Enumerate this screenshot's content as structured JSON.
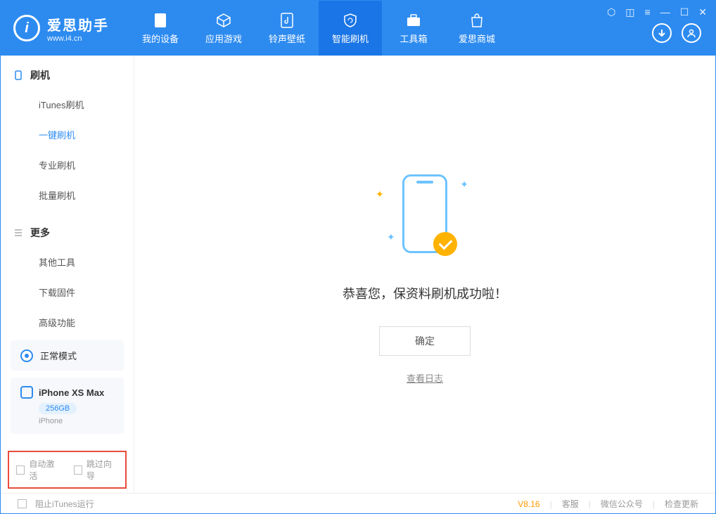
{
  "logo": {
    "title": "爱思助手",
    "url": "www.i4.cn",
    "mark": "i"
  },
  "nav": [
    {
      "label": "我的设备"
    },
    {
      "label": "应用游戏"
    },
    {
      "label": "铃声壁纸"
    },
    {
      "label": "智能刷机"
    },
    {
      "label": "工具箱"
    },
    {
      "label": "爱思商城"
    }
  ],
  "sidebar": {
    "section1": {
      "title": "刷机",
      "items": [
        "iTunes刷机",
        "一键刷机",
        "专业刷机",
        "批量刷机"
      ]
    },
    "section2": {
      "title": "更多",
      "items": [
        "其他工具",
        "下载固件",
        "高级功能"
      ]
    },
    "mode": "正常模式",
    "device": {
      "name": "iPhone XS Max",
      "capacity": "256GB",
      "type": "iPhone"
    },
    "checkboxes": [
      "自动激活",
      "跳过向导"
    ]
  },
  "main": {
    "message": "恭喜您，保资料刷机成功啦！",
    "ok": "确定",
    "log": "查看日志"
  },
  "footer": {
    "block_itunes": "阻止iTunes运行",
    "version": "V8.16",
    "links": [
      "客服",
      "微信公众号",
      "检查更新"
    ]
  }
}
